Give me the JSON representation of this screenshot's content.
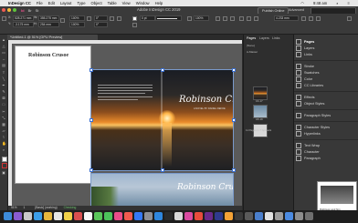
{
  "menubar": {
    "app": "InDesign CC",
    "items": [
      "File",
      "Edit",
      "Layout",
      "Type",
      "Object",
      "Table",
      "View",
      "Window",
      "Help"
    ],
    "clock": "9:48 am"
  },
  "appbar": {
    "title": "Adobe InDesign CC 2019",
    "publish_label": "Publish Online",
    "workspace": "Advanced"
  },
  "control": {
    "x": "528.271 mm",
    "y": "-3.175 mm",
    "w": "355.275 mm",
    "h": "254 mm",
    "angle": "0°",
    "shear": "0°",
    "stroke": "0 pt",
    "scale": "100%",
    "width_field": "4.233 mm"
  },
  "document": {
    "tab": "*Untitled-1 @ 51% [GPU Preview]",
    "page_title": "Robinson Crusoe",
    "book_title": "Robinson Crusoe",
    "book_subtitle": "A NOVEL BY DANIEL DEFOE"
  },
  "status": {
    "zoom": "51%",
    "page": "1",
    "mode": "[Basic] (working)",
    "errors": "Checking"
  },
  "pages_panel": {
    "tabs": [
      "Pages",
      "Layers",
      "Links"
    ],
    "master_none": "[None]",
    "master_a": "A-Master",
    "spreads": [
      {
        "label": "16-17"
      },
      {
        "label": "18-19"
      },
      {
        "label": "18-19"
      }
    ],
    "footer": "11 Pages in 7 Spreads"
  },
  "side_panel": {
    "items": [
      {
        "label": "Pages",
        "icon": "pages-icon",
        "active": true
      },
      {
        "label": "Layers",
        "icon": "layers-icon",
        "active": false
      },
      {
        "label": "Links",
        "icon": "links-icon",
        "active": false
      },
      {
        "label": "Stroke",
        "icon": "stroke-icon",
        "active": false
      },
      {
        "label": "Swatches",
        "icon": "swatches-icon",
        "active": false
      },
      {
        "label": "Color",
        "icon": "color-icon",
        "active": false
      },
      {
        "label": "CC Libraries",
        "icon": "cc-libraries-icon",
        "active": false
      },
      {
        "label": "Effects",
        "icon": "effects-icon",
        "active": false
      },
      {
        "label": "Object Styles",
        "icon": "object-styles-icon",
        "active": false
      },
      {
        "label": "Paragraph Styles",
        "icon": "paragraph-styles-icon",
        "active": false
      },
      {
        "label": "Character Styles",
        "icon": "character-styles-icon",
        "active": false
      },
      {
        "label": "Hyperlinks",
        "icon": "hyperlinks-icon",
        "active": false
      },
      {
        "label": "Text Wrap",
        "icon": "text-wrap-icon",
        "active": false
      },
      {
        "label": "Character",
        "icon": "character-icon",
        "active": false
      },
      {
        "label": "Paragraph",
        "icon": "paragraph-icon",
        "active": false
      }
    ],
    "preview_caption": "Robinson and him"
  },
  "colors": {
    "accent": "#3a6fd0",
    "panel": "#383838",
    "canvas": "#5a5a5a"
  }
}
